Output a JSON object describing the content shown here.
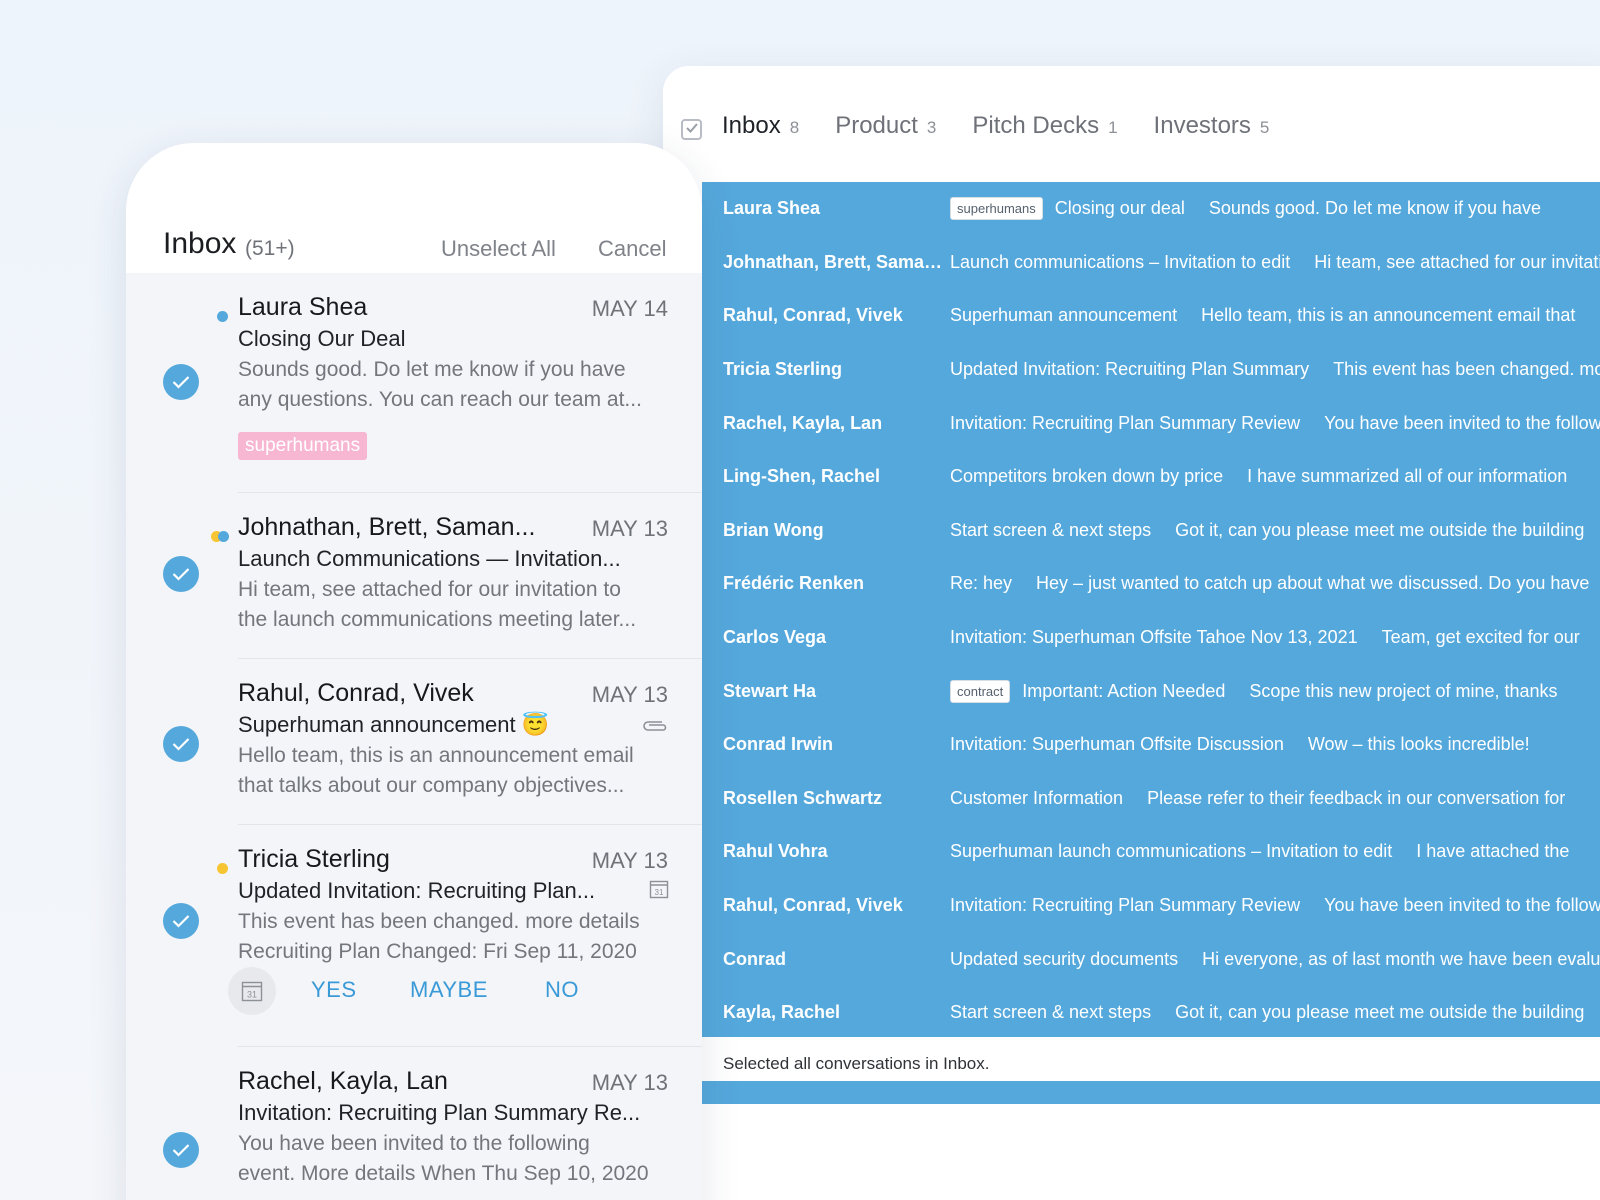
{
  "desktop": {
    "tabs": [
      {
        "label": "Inbox",
        "count": "8"
      },
      {
        "label": "Product",
        "count": "3"
      },
      {
        "label": "Pitch Decks",
        "count": "1"
      },
      {
        "label": "Investors",
        "count": "5"
      }
    ],
    "rows": [
      {
        "from": "Laura Shea",
        "label": "superhumans",
        "subject": "Closing our deal",
        "snippet": "Sounds good. Do let me know if you have"
      },
      {
        "from": "Johnathan, Brett, Saman...",
        "label": "",
        "subject": "Launch communications – Invitation to edit",
        "snippet": "Hi team, see attached for our invitation"
      },
      {
        "from": "Rahul, Conrad, Vivek",
        "label": "",
        "subject": "Superhuman announcement",
        "snippet": "Hello team, this is an announcement email that"
      },
      {
        "from": "Tricia Sterling",
        "label": "",
        "subject": "Updated Invitation: Recruiting Plan Summary",
        "snippet": "This event has been changed. more details"
      },
      {
        "from": "Rachel, Kayla, Lan",
        "label": "",
        "subject": "Invitation: Recruiting Plan Summary Review",
        "snippet": "You have been invited to the following event"
      },
      {
        "from": "Ling-Shen, Rachel",
        "label": "",
        "subject": "Competitors broken down by price",
        "snippet": "I have summarized all of our information"
      },
      {
        "from": "Brian Wong",
        "label": "",
        "subject": "Start screen & next steps",
        "snippet": "Got it, can you please meet me outside the building"
      },
      {
        "from": "Frédéric Renken",
        "label": "",
        "subject": "Re: hey",
        "snippet": "Hey – just wanted to catch up about what we discussed. Do you have"
      },
      {
        "from": "Carlos Vega",
        "label": "",
        "subject": "Invitation: Superhuman Offsite Tahoe Nov 13, 2021",
        "snippet": "Team, get excited for our"
      },
      {
        "from": "Stewart Ha",
        "label": "contract",
        "subject": "Important: Action Needed",
        "snippet": "Scope this new project of mine, thanks"
      },
      {
        "from": "Conrad Irwin",
        "label": "",
        "subject": "Invitation: Superhuman Offsite Discussion",
        "snippet": "Wow – this looks incredible!"
      },
      {
        "from": "Rosellen Schwartz",
        "label": "",
        "subject": "Customer Information",
        "snippet": "Please refer to their feedback in our conversation for"
      },
      {
        "from": "Rahul Vohra",
        "label": "",
        "subject": "Superhuman launch communications – Invitation to edit",
        "snippet": "I have attached the"
      },
      {
        "from": "Rahul, Conrad, Vivek",
        "label": "",
        "subject": "Invitation: Recruiting Plan Summary Review",
        "snippet": "You have been invited to the following event"
      },
      {
        "from": "Conrad",
        "label": "",
        "subject": "Updated security documents",
        "snippet": "Hi everyone, as of last month we have been evaluating"
      },
      {
        "from": "Kayla, Rachel",
        "label": "",
        "subject": "Start screen & next steps",
        "snippet": "Got it, can you please meet me outside the building"
      }
    ],
    "status": "Selected all conversations in Inbox."
  },
  "mobile": {
    "title": "Inbox",
    "count": "(51+)",
    "unselect_all": "Unselect All",
    "cancel": "Cancel",
    "items": [
      {
        "from": "Laura Shea",
        "date": "MAY 14",
        "subject": "Closing Our Deal",
        "snippet1": "Sounds good. Do let me know if you have",
        "snippet2": "any questions. You can reach our team at...",
        "tag": "superhumans"
      },
      {
        "from": "Johnathan, Brett, Saman...",
        "date": "MAY 13",
        "subject": "Launch Communications — Invitation...",
        "snippet1": "Hi team, see attached for our invitation to",
        "snippet2": "the launch communications meeting later..."
      },
      {
        "from": "Rahul, Conrad, Vivek",
        "date": "MAY 13",
        "subject": "Superhuman announcement 😇",
        "snippet1": "Hello team, this is an announcement email",
        "snippet2": "that talks about our company objectives..."
      },
      {
        "from": "Tricia Sterling",
        "date": "MAY 13",
        "subject": "Updated Invitation: Recruiting Plan...",
        "snippet1": "This event has been changed. more details",
        "snippet2": "Recruiting Plan Changed: Fri Sep 11, 2020"
      },
      {
        "from": "Rachel, Kayla, Lan",
        "date": "MAY 13",
        "subject": "Invitation: Recruiting Plan Summary Re...",
        "snippet1": "You have been invited to the following",
        "snippet2": "event. More details When Thu Sep 10, 2020"
      }
    ],
    "rsvp": {
      "yes": "YES",
      "maybe": "MAYBE",
      "no": "NO",
      "cal_day": "31"
    },
    "colors": {
      "accent": "#55a8dc",
      "tag": "#f7b6d2",
      "dot_blue": "#55a8dc",
      "dot_yellow": "#f7c531"
    }
  }
}
